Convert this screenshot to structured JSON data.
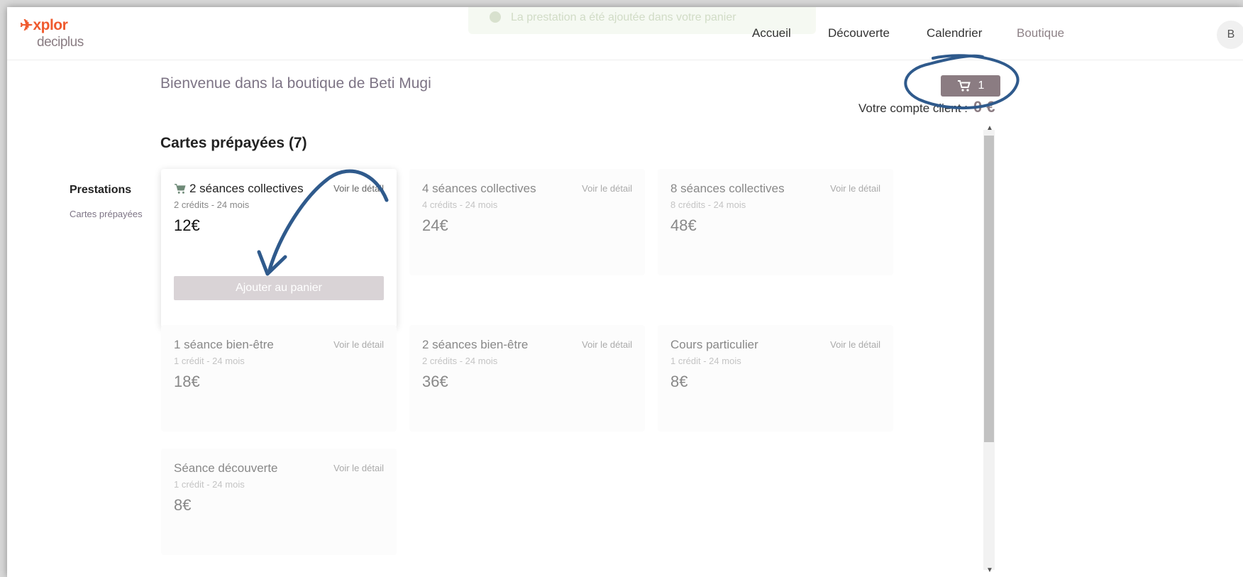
{
  "header": {
    "logo_top": "xplor",
    "logo_bottom": "deciplus",
    "toast": "La prestation a été ajoutée dans votre panier",
    "nav": [
      "Accueil",
      "Découverte",
      "Calendrier",
      "Boutique"
    ],
    "avatar": "B"
  },
  "main": {
    "welcome": "Bienvenue dans la boutique de  Beti Mugi",
    "cart_count": "1",
    "account_label": "Votre compte client :",
    "account_value": "0 €",
    "section_title": "Cartes prépayées (7)"
  },
  "sidebar": {
    "title": "Prestations",
    "items": [
      "Cartes prépayées"
    ]
  },
  "cards": [
    {
      "title": "2 séances collectives",
      "detail": "Voir le détail",
      "sub": "2 crédits - 24 mois",
      "price": "12€",
      "button": "Ajouter au panier"
    },
    {
      "title": "4 séances collectives",
      "detail": "Voir le détail",
      "sub": "4 crédits - 24 mois",
      "price": "24€"
    },
    {
      "title": "8 séances collectives",
      "detail": "Voir le détail",
      "sub": "8 crédits - 24 mois",
      "price": "48€"
    },
    {
      "title": "1 séance bien-être",
      "detail": "Voir le détail",
      "sub": "1 crédit - 24 mois",
      "price": "18€"
    },
    {
      "title": "2 séances bien-être",
      "detail": "Voir le détail",
      "sub": "2 crédits - 24 mois",
      "price": "36€"
    },
    {
      "title": "Cours particulier",
      "detail": "Voir le détail",
      "sub": "1 crédit - 24 mois",
      "price": "8€"
    },
    {
      "title": "Séance découverte",
      "detail": "Voir le détail",
      "sub": "1 crédit - 24 mois",
      "price": "8€"
    }
  ],
  "colors": {
    "brand_orange": "#ef5b2f",
    "accent_mauve": "#8b7c82",
    "annotation_blue": "#2f5a8c"
  },
  "icons": [
    "rocket-icon",
    "cart-icon",
    "check-circle-icon",
    "scroll-up-icon",
    "scroll-down-icon"
  ]
}
